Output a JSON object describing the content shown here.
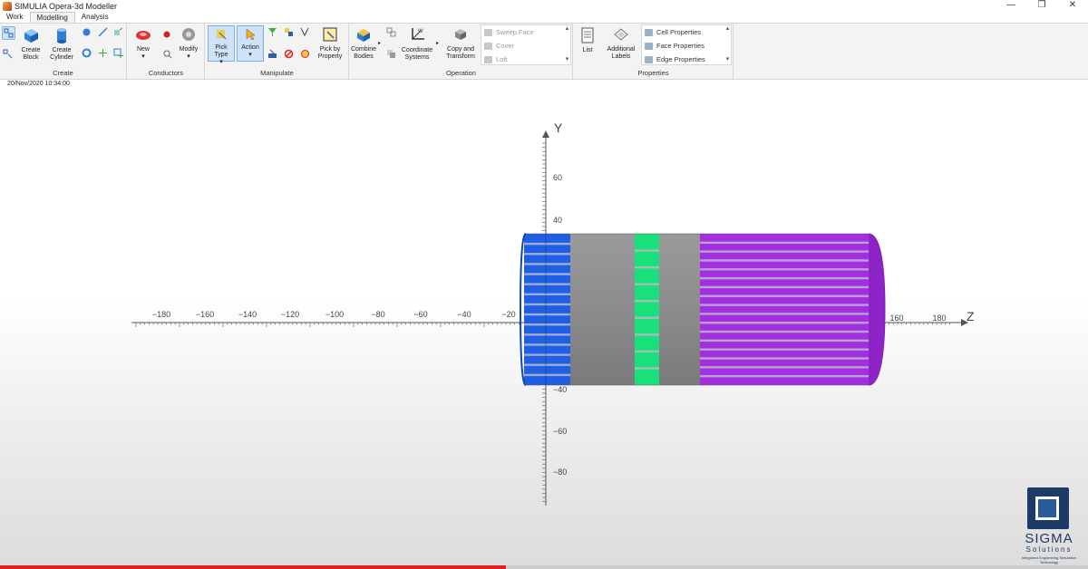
{
  "window": {
    "title": "SIMULIA Opera-3d Modeller",
    "controls": [
      "—",
      "❐",
      "✕"
    ]
  },
  "tabs": [
    {
      "label": "Work",
      "active": false
    },
    {
      "label": "Modelling",
      "active": true
    },
    {
      "label": "Analysis",
      "active": false
    }
  ],
  "ribbon": {
    "create": {
      "label": "Create",
      "create_block": "Create\nBlock",
      "create_cylinder": "Create\nCylinder"
    },
    "conductors": {
      "label": "Conductors",
      "new": "New",
      "modify": "Modify"
    },
    "manipulate": {
      "label": "Manipulate",
      "pick_type": "Pick\nType",
      "action": "Action",
      "pick_by_property": "Pick by\nProperty"
    },
    "operation": {
      "label": "Operation",
      "combine_bodies": "Combine\nBodies",
      "coordinate_systems": "Coordinate\nSystems",
      "copy_and_transform": "Copy and\nTransform",
      "gallery": [
        "Sweep Face",
        "Cover",
        "Loft"
      ]
    },
    "properties": {
      "label": "Properties",
      "list": "List",
      "additional_labels": "Additional\nLabels",
      "gallery": [
        "Cell Properties",
        "Face Properties",
        "Edge Properties"
      ]
    }
  },
  "timestamp": "20/Nov/2020 10:34:00",
  "scene": {
    "axes": {
      "y_name": "Y",
      "z_name": "Z",
      "z_tick_labels": [
        "−180",
        "−160",
        "−140",
        "−120",
        "−100",
        "−80",
        "−60",
        "−40",
        "−20",
        "160",
        "180"
      ],
      "y_tick_labels": [
        "60",
        "40",
        "−40",
        "−60",
        "−80"
      ]
    },
    "colors": {
      "blue": "#1f5fe6",
      "grey": "#8a8a8a",
      "green": "#19e07a",
      "purple": "#a42fe0",
      "stripe": "#b8b8c8"
    }
  },
  "logo": {
    "word": "SIGMA",
    "sub": "Solutions",
    "tag": "Integrated Engineering Simulation Technology"
  },
  "video_progress": 0.465
}
